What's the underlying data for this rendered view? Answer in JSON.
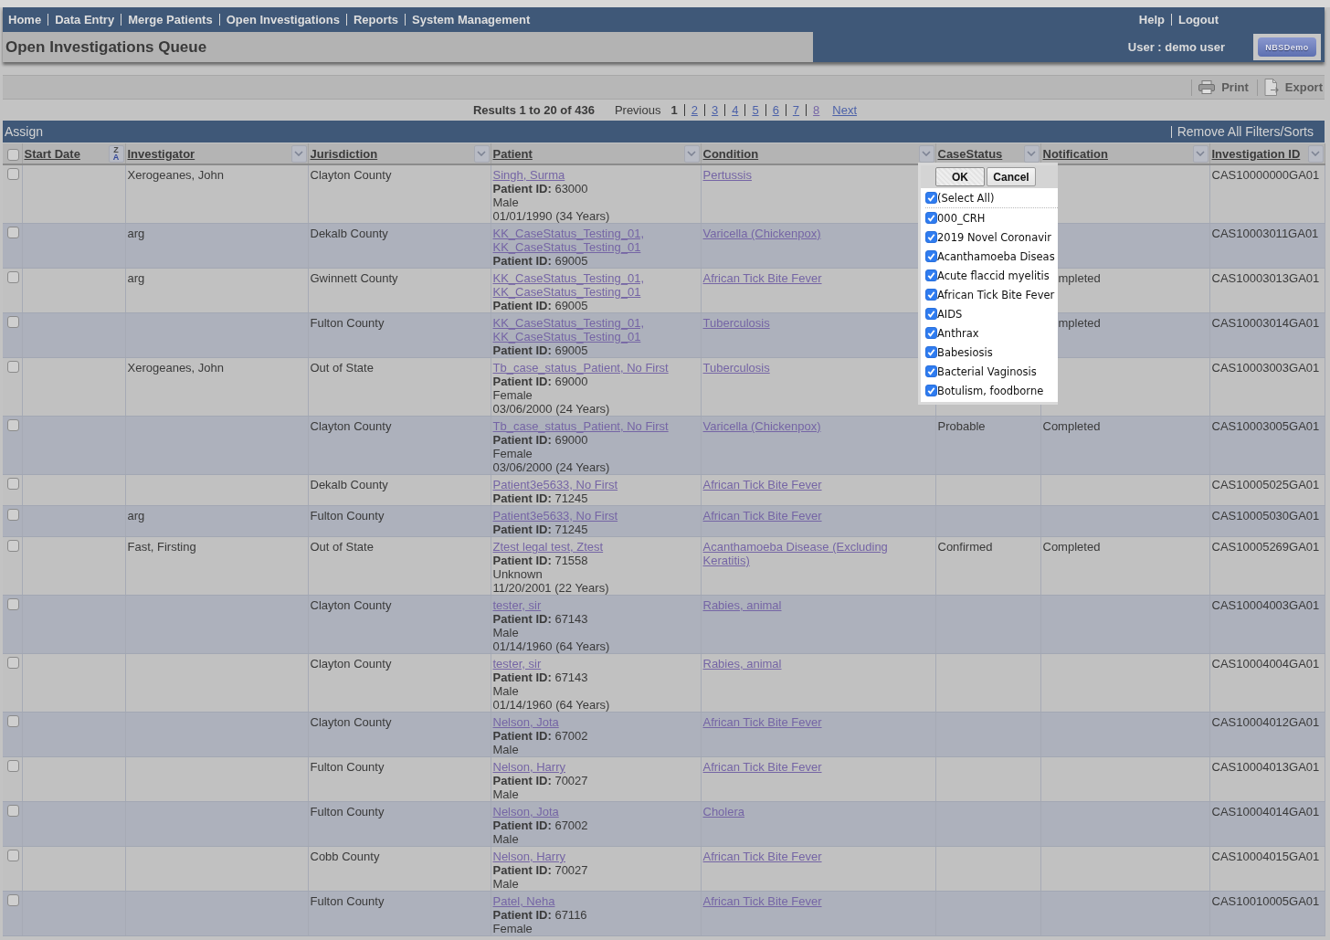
{
  "nav": {
    "links": [
      "Home",
      "Data Entry",
      "Merge Patients",
      "Open Investigations",
      "Reports",
      "System Management"
    ],
    "utility_links": [
      "Help",
      "Logout"
    ]
  },
  "header": {
    "title": "Open Investigations Queue",
    "user": "User : demo user",
    "logo": "NBSDemo"
  },
  "toolbar": {
    "actions": [
      {
        "kind": "print",
        "label": "Print"
      },
      {
        "kind": "export",
        "label": "Export"
      }
    ]
  },
  "pagination": {
    "summary": "Results 1 to 20 of 436",
    "previous": {
      "label": "Previous",
      "disabled": true
    },
    "pages": [
      {
        "label": "1",
        "selected": true
      },
      {
        "label": "2",
        "selected": false,
        "visited": false
      },
      {
        "label": "3",
        "selected": false,
        "visited": false
      },
      {
        "label": "4",
        "selected": false,
        "visited": false
      },
      {
        "label": "5",
        "selected": false,
        "visited": false
      },
      {
        "label": "6",
        "selected": false,
        "visited": false
      },
      {
        "label": "7",
        "selected": false,
        "visited": false
      },
      {
        "label": "8",
        "selected": false,
        "visited": true
      }
    ],
    "next": "Next"
  },
  "action_bar": {
    "assign": "Assign",
    "remove_filters": "Remove All Filters/Sorts"
  },
  "table": {
    "select_all_checked": false,
    "columns": [
      {
        "label": "Start Date",
        "kind": "sort",
        "sort_letters": [
          "Z",
          "A"
        ]
      },
      {
        "label": "Investigator",
        "kind": "filter"
      },
      {
        "label": "Jurisdiction",
        "kind": "filter"
      },
      {
        "label": "Patient",
        "kind": "filter"
      },
      {
        "label": "Condition",
        "kind": "filter"
      },
      {
        "label": "CaseStatus",
        "kind": "filter"
      },
      {
        "label": "Notification",
        "kind": "filter"
      },
      {
        "label": "Investigation ID",
        "kind": "filter"
      }
    ],
    "rows": [
      {
        "checked": false,
        "investigator": "Xerogeanes, John",
        "jurisdiction": "Clayton County",
        "patient": {
          "name": "Singh, Surma",
          "id_line": "**Patient ID:** 63000",
          "details": [
            "Male",
            "01/01/1990 (34 Years)"
          ]
        },
        "condition": "Pertussis",
        "investigation_id": "CAS10000000GA01"
      },
      {
        "checked": false,
        "investigator": "arg",
        "jurisdiction": "Dekalb County",
        "patient": {
          "name": "KK_CaseStatus_Testing_01, KK_CaseStatus_Testing_01",
          "id_line": "**Patient ID:** 69005"
        },
        "condition": "Varicella (Chickenpox)",
        "investigation_id": "CAS10003011GA01"
      },
      {
        "checked": false,
        "investigator": "arg",
        "jurisdiction": "Gwinnett County",
        "patient": {
          "name": "KK_CaseStatus_Testing_01, KK_CaseStatus_Testing_01",
          "id_line": "**Patient ID:** 69005"
        },
        "condition": "African Tick Bite Fever",
        "notification": "mpleted",
        "notification_under_popup": true,
        "investigation_id": "CAS10003013GA01"
      },
      {
        "checked": false,
        "jurisdiction": "Fulton County",
        "patient": {
          "name": "KK_CaseStatus_Testing_01, KK_CaseStatus_Testing_01",
          "id_line": "**Patient ID:** 69005"
        },
        "condition": "Tuberculosis",
        "notification": "mpleted",
        "notification_under_popup": true,
        "investigation_id": "CAS10003014GA01"
      },
      {
        "checked": false,
        "investigator": "Xerogeanes, John",
        "jurisdiction": "Out of State",
        "patient": {
          "name": "Tb_case_status_Patient, No First",
          "id_line": "**Patient ID:** 69000",
          "details": [
            "Female",
            "03/06/2000 (24 Years)"
          ]
        },
        "condition": "Tuberculosis",
        "investigation_id": "CAS10003003GA01"
      },
      {
        "checked": false,
        "jurisdiction": "Clayton County",
        "patient": {
          "name": "Tb_case_status_Patient, No First",
          "id_line": "**Patient ID:** 69000",
          "details": [
            "Female",
            "03/06/2000 (24 Years)"
          ]
        },
        "condition": "Varicella (Chickenpox)",
        "case_status": "Probable",
        "notification": "Completed",
        "investigation_id": "CAS10003005GA01"
      },
      {
        "checked": false,
        "jurisdiction": "Dekalb County",
        "patient": {
          "name": "Patient3e5633, No First",
          "id_line": "**Patient ID:** 71245"
        },
        "condition": "African Tick Bite Fever",
        "investigation_id": "CAS10005025GA01"
      },
      {
        "checked": false,
        "investigator": "arg",
        "jurisdiction": "Fulton County",
        "patient": {
          "name": "Patient3e5633, No First",
          "id_line": "**Patient ID:** 71245"
        },
        "condition": "African Tick Bite Fever",
        "investigation_id": "CAS10005030GA01"
      },
      {
        "checked": false,
        "investigator": "Fast, Firsting",
        "jurisdiction": "Out of State",
        "patient": {
          "name": "Ztest legal test, Ztest",
          "id_line": "**Patient ID:** 71558",
          "details": [
            "Unknown",
            "11/20/2001 (22 Years)"
          ]
        },
        "condition": "Acanthamoeba Disease (Excluding Keratitis)",
        "case_status": "Confirmed",
        "notification": "Completed",
        "investigation_id": "CAS10005269GA01"
      },
      {
        "checked": false,
        "jurisdiction": "Clayton County",
        "patient": {
          "name": "tester, sir",
          "id_line": "**Patient ID:** 67143",
          "details": [
            "Male",
            "01/14/1960 (64 Years)"
          ]
        },
        "condition": "Rabies, animal",
        "investigation_id": "CAS10004003GA01"
      },
      {
        "checked": false,
        "jurisdiction": "Clayton County",
        "patient": {
          "name": "tester, sir",
          "id_line": "**Patient ID:** 67143",
          "details": [
            "Male",
            "01/14/1960 (64 Years)"
          ]
        },
        "condition": "Rabies, animal",
        "investigation_id": "CAS10004004GA01"
      },
      {
        "checked": false,
        "jurisdiction": "Clayton County",
        "patient": {
          "name": "Nelson, Jota",
          "id_line": "**Patient ID:** 67002",
          "details": [
            "Male"
          ]
        },
        "condition": "African Tick Bite Fever",
        "investigation_id": "CAS10004012GA01"
      },
      {
        "checked": false,
        "jurisdiction": "Fulton County",
        "patient": {
          "name": "Nelson, Harry",
          "id_line": "**Patient ID:** 70027",
          "details": [
            "Male"
          ]
        },
        "condition": "African Tick Bite Fever",
        "investigation_id": "CAS10004013GA01"
      },
      {
        "checked": false,
        "jurisdiction": "Fulton County",
        "patient": {
          "name": "Nelson, Jota",
          "id_line": "**Patient ID:** 67002",
          "details": [
            "Male"
          ]
        },
        "condition": "Cholera",
        "investigation_id": "CAS10004014GA01"
      },
      {
        "checked": false,
        "jurisdiction": "Cobb County",
        "patient": {
          "name": "Nelson, Harry",
          "id_line": "**Patient ID:** 70027",
          "details": [
            "Male"
          ]
        },
        "condition": "African Tick Bite Fever",
        "investigation_id": "CAS10004015GA01"
      },
      {
        "checked": false,
        "jurisdiction": "Fulton County",
        "patient": {
          "name": "Patel, Neha",
          "id_line": "**Patient ID:** 67116",
          "details": [
            "Female"
          ]
        },
        "condition": "African Tick Bite Fever",
        "investigation_id": "CAS10010005GA01"
      }
    ]
  },
  "filter_popup": {
    "buttons": [
      {
        "kind": "confirm",
        "label": "OK"
      },
      {
        "kind": "cancel",
        "label": "Cancel"
      }
    ],
    "items": [
      {
        "kind": "select_all",
        "label": "(Select All)",
        "checked": true
      },
      {
        "kind": "option",
        "label": "000_CRH",
        "checked": true
      },
      {
        "kind": "option",
        "label": "2019 Novel Coronavir",
        "checked": true
      },
      {
        "kind": "option",
        "label": "Acanthamoeba Diseas",
        "checked": true
      },
      {
        "kind": "option",
        "label": "Acute flaccid myelitis",
        "checked": true
      },
      {
        "kind": "option",
        "label": "African Tick Bite Fever",
        "checked": true
      },
      {
        "kind": "option",
        "label": "AIDS",
        "checked": true
      },
      {
        "kind": "option",
        "label": "Anthrax",
        "checked": true
      },
      {
        "kind": "option",
        "label": "Babesiosis",
        "checked": true
      },
      {
        "kind": "option",
        "label": "Bacterial Vaginosis",
        "checked": true
      },
      {
        "kind": "option",
        "label": "Botulism, foodborne",
        "checked": true
      }
    ]
  }
}
